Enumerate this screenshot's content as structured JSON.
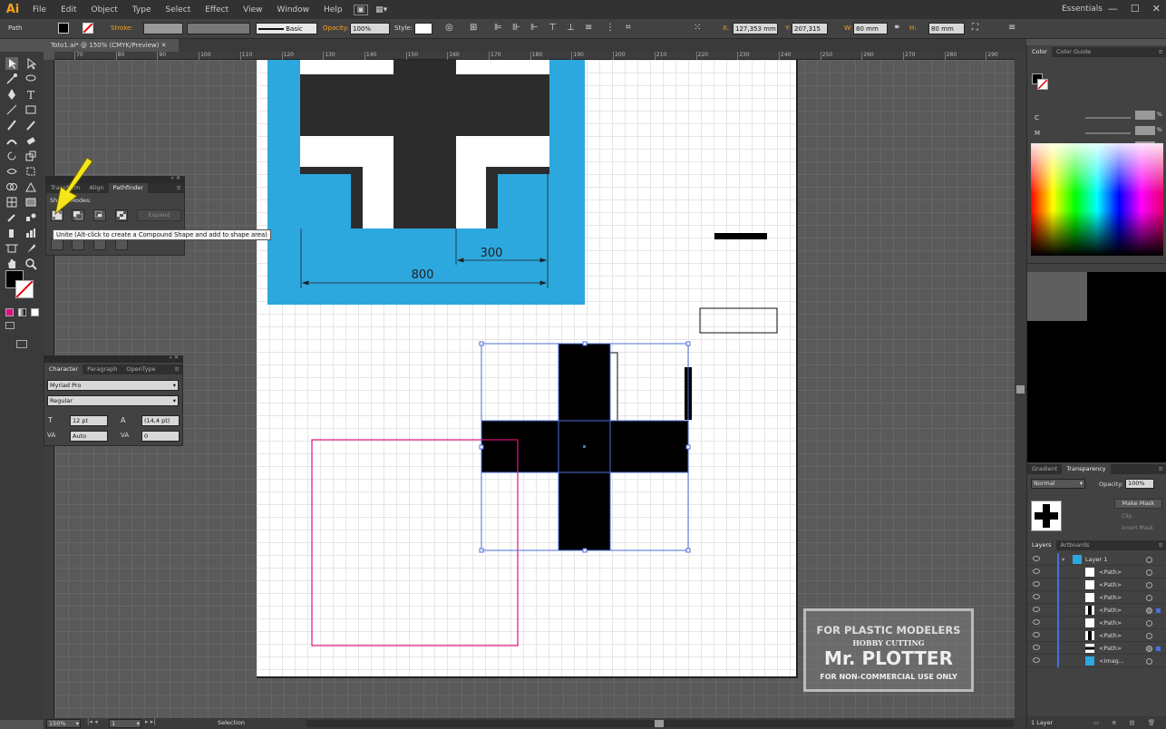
{
  "app": {
    "logo": "Ai"
  },
  "menu": [
    "File",
    "Edit",
    "Object",
    "Type",
    "Select",
    "Effect",
    "View",
    "Window",
    "Help"
  ],
  "workspace": "Essentials",
  "control": {
    "selection_type": "Path",
    "stroke_label": "Stroke:",
    "brush": "Basic",
    "opacity_label": "Opacity:",
    "opacity": "100%",
    "style_label": "Style:",
    "x_label": "X:",
    "x": "127,353 mm",
    "y_label": "Y:",
    "y": "207,315 mm",
    "w_label": "W:",
    "w": "80 mm",
    "h_label": "H:",
    "h": "80 mm"
  },
  "doc_tab": {
    "title": "Toto1.ai* @ 150% (CMYK/Preview)"
  },
  "ruler": {
    "h_ticks": [
      "70",
      "80",
      "90",
      "100",
      "110",
      "120",
      "130",
      "140",
      "150",
      "160",
      "170",
      "180",
      "190",
      "200",
      "210",
      "220",
      "230",
      "240",
      "250",
      "260",
      "270",
      "280",
      "290"
    ]
  },
  "drawing": {
    "dim_small": "300",
    "dim_large": "800"
  },
  "pathfinder": {
    "tabs": [
      "Transform",
      "Align",
      "Pathfinder"
    ],
    "shape_modes_label": "Shape Modes:",
    "expand_label": "Expand",
    "tooltip": "Unite (Alt-click to create a Compound Shape and add to shape area)"
  },
  "character": {
    "tabs": [
      "Character",
      "Paragraph",
      "OpenType"
    ],
    "font": "Myriad Pro",
    "style": "Regular",
    "size": "12 pt",
    "leading": "(14,4 pt)",
    "kerning": "Auto",
    "tracking": "0"
  },
  "color_panel": {
    "tabs": [
      "Color",
      "Color Guide"
    ],
    "channels": [
      {
        "name": "C",
        "value": "%"
      },
      {
        "name": "M",
        "value": "%"
      },
      {
        "name": "Y",
        "value": "%"
      },
      {
        "name": "K",
        "value": "%"
      }
    ]
  },
  "transparency": {
    "tabs": [
      "Gradient",
      "Transparency"
    ],
    "blend": "Normal",
    "opacity_label": "Opacity:",
    "opacity": "100%",
    "make_mask": "Make Mask",
    "clip": "Clip",
    "invert": "Invert Mask"
  },
  "layers": {
    "tabs": [
      "Layers",
      "Artboards"
    ],
    "rows": [
      "Layer 1",
      "<Path>",
      "<Path>",
      "<Path>",
      "<Path>",
      "<Path>",
      "<Path>",
      "<Path>",
      "<Imag..."
    ],
    "count": "1 Layer"
  },
  "status": {
    "zoom": "150%",
    "artboard": "1",
    "tool": "Selection"
  },
  "watermark": {
    "line1": "FOR PLASTIC MODELERS",
    "line2": "HOBBY CUTTING",
    "line3": "Mr. PLOTTER",
    "line4": "FOR NON-COMMERCIAL USE ONLY"
  },
  "colors": {
    "accent": "#f7a21b",
    "blue": "#2da8df",
    "magenta": "#e0117f",
    "selection": "#4b6fd8",
    "arrow": "#f5e61b"
  }
}
